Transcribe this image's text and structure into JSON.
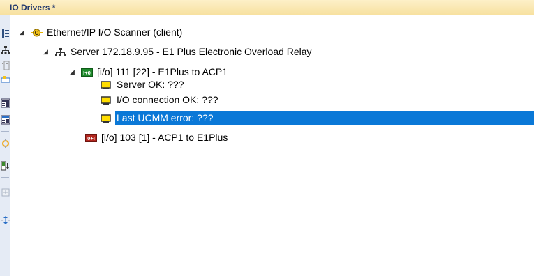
{
  "panel": {
    "title": "IO Drivers *"
  },
  "toolbar": {
    "buttons": [
      "tree-view-icon",
      "network-icon",
      "properties-icon",
      "connect-icon",
      "import-icon",
      "export-icon",
      "refresh-icon",
      "download-icon",
      "add-icon",
      "move-icon"
    ]
  },
  "tree": {
    "scanner": {
      "label": "Ethernet/IP I/O Scanner (client)"
    },
    "server": {
      "label": "Server 172.18.9.95 - E1 Plus Electronic Overload Relay"
    },
    "input_block": {
      "badge": "I+0",
      "label": "[i/o] 111 [22] - E1Plus to ACP1"
    },
    "status_items": [
      {
        "label": "Server OK: ???"
      },
      {
        "label": "I/O connection OK: ???"
      },
      {
        "label": "Last UCMM error: ???"
      }
    ],
    "output_block": {
      "badge": "0+I",
      "label": "[i/o] 103 [1] - ACP1 to E1Plus"
    },
    "colors": {
      "selection": "#0a78d7",
      "status_icon": "#ffdd00",
      "input_badge": "#1f8a2c",
      "output_badge": "#b3261e"
    }
  }
}
